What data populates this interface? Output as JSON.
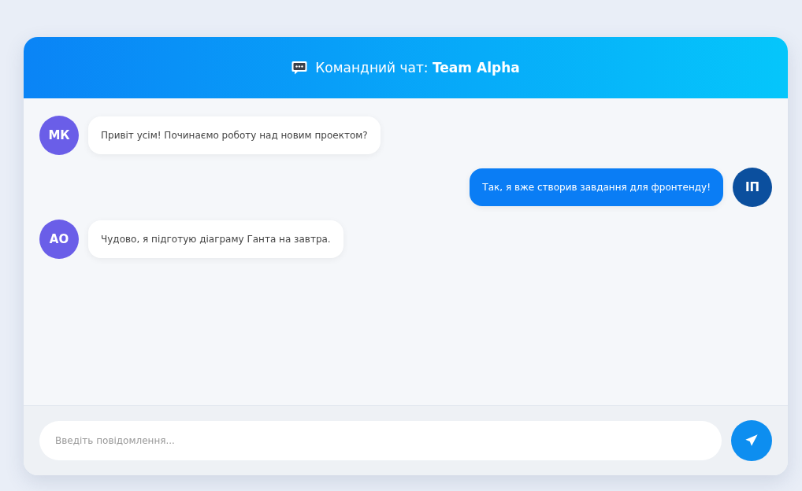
{
  "header": {
    "title": "Командний чат: **Team Alpha**"
  },
  "messages": [
    {
      "kind": "incoming",
      "avatar": "МК",
      "color": "#6a5ee8",
      "text": "Привіт усім! Починаємо роботу над новим проектом?"
    },
    {
      "kind": "outgoing",
      "avatar": "ІП",
      "color": "#0b4f9e",
      "text": "Так, я вже створив завдання для фронтенду!"
    },
    {
      "kind": "incoming",
      "avatar": "АО",
      "color": "#6a5ee8",
      "text": "Чудово, я підготую діаграму Ганта на завтра."
    }
  ],
  "composer": {
    "placeholder": "Введіть повідомлення..."
  }
}
